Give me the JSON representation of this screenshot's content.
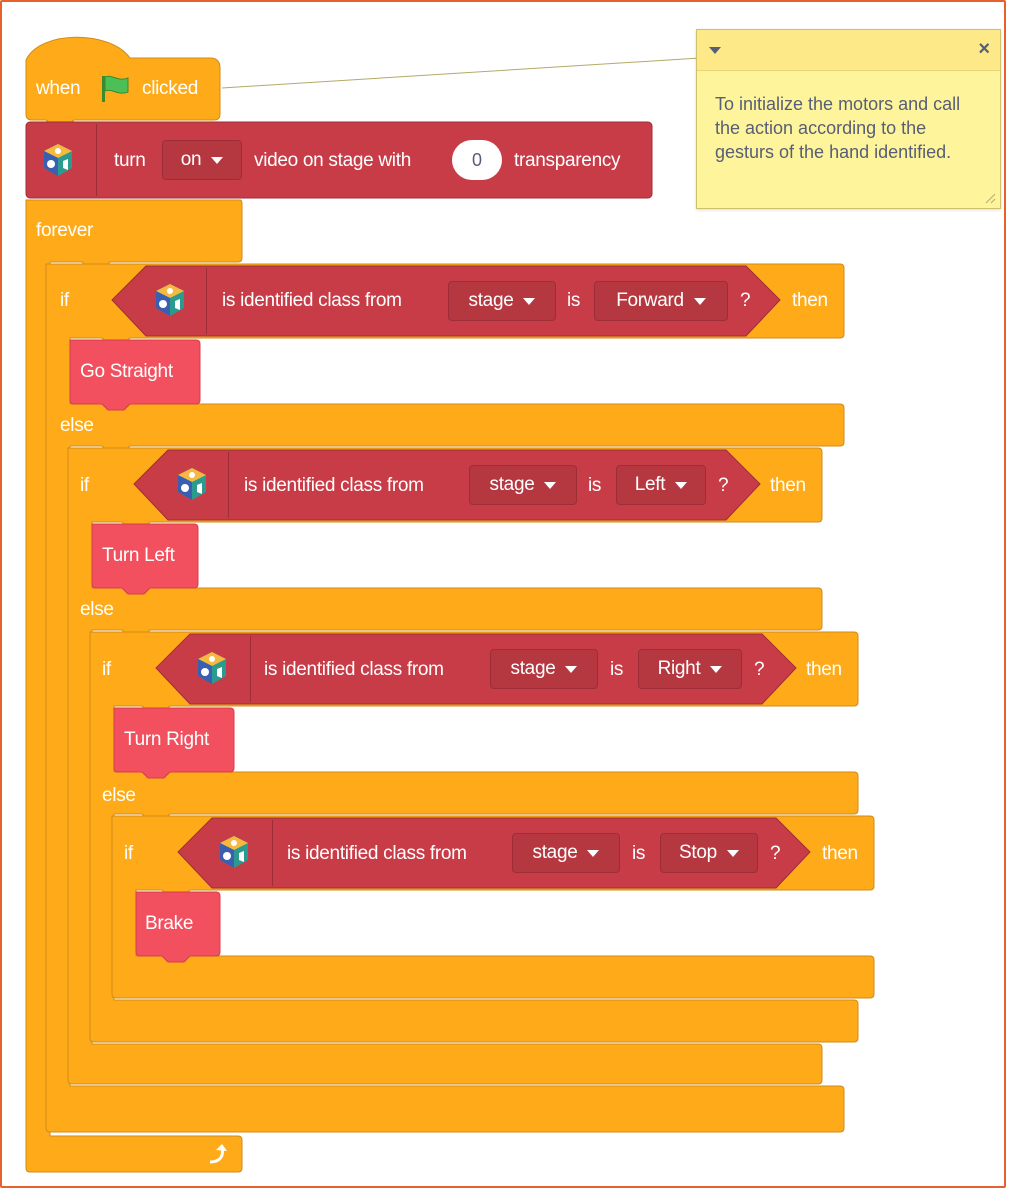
{
  "hat": {
    "when": "when",
    "clicked": "clicked",
    "flag_icon": "green-flag-icon"
  },
  "video": {
    "turn": "turn",
    "state": "on",
    "video_text": "video on stage with",
    "transparency_value": "0",
    "transparency": "transparency"
  },
  "forever": {
    "label": "forever",
    "loop_icon": "loop-arrow-icon"
  },
  "conditions": [
    {
      "if": "if",
      "text": "is identified class from",
      "source": "stage",
      "is": "is",
      "class": "Forward",
      "q": "?",
      "then": "then",
      "action": "Go Straight",
      "else": "else"
    },
    {
      "if": "if",
      "text": "is identified class from",
      "source": "stage",
      "is": "is",
      "class": "Left",
      "q": "?",
      "then": "then",
      "action": "Turn Left",
      "else": "else"
    },
    {
      "if": "if",
      "text": "is identified class from",
      "source": "stage",
      "is": "is",
      "class": "Right",
      "q": "?",
      "then": "then",
      "action": "Turn Right",
      "else": "else"
    },
    {
      "if": "if",
      "text": "is identified class from",
      "source": "stage",
      "is": "is",
      "class": "Stop",
      "q": "?",
      "then": "then",
      "action": "Brake"
    }
  ],
  "comment": {
    "text": "To initialize the motors and call the action according to the gesturs of the hand identified.",
    "close": "×"
  },
  "colors": {
    "control": "#ffab19",
    "extension": "#c83c47",
    "myblock": "#f2505f",
    "comment": "#fef49c"
  }
}
